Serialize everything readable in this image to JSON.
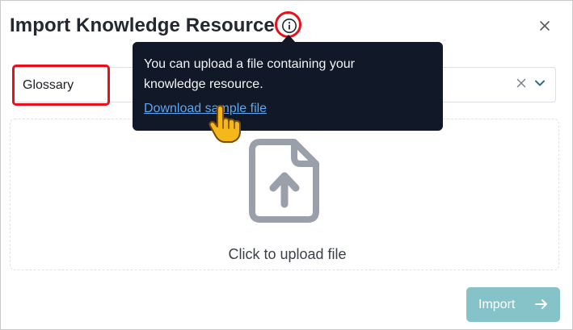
{
  "dialog": {
    "title": "Import Knowledge Resource",
    "close_icon": "close-icon",
    "info_icon": "info-icon"
  },
  "resource_select": {
    "value": "Glossary",
    "clear_icon": "clear-icon",
    "chevron_icon": "chevron-down-icon"
  },
  "tooltip": {
    "text": "You can upload a file containing your knowledge resource.",
    "link": "Download sample file"
  },
  "dropzone": {
    "icon": "file-upload-icon",
    "label": "Click to upload file"
  },
  "footer": {
    "import_label": "Import",
    "import_icon": "arrow-right-icon"
  },
  "colors": {
    "highlight": "#e8101a",
    "tooltip_bg": "#111827",
    "link": "#5aa7f2",
    "import_button": "#86c3c8",
    "icon_gray": "#9aa0aa"
  }
}
